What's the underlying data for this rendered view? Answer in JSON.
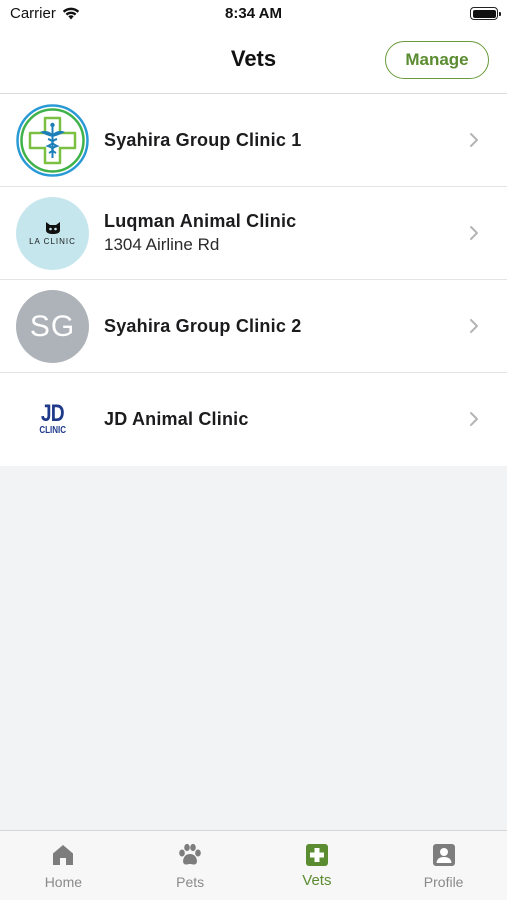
{
  "status_bar": {
    "carrier": "Carrier",
    "time": "8:34 AM"
  },
  "nav": {
    "title": "Vets",
    "manage_label": "Manage"
  },
  "vets": [
    {
      "name": "Syahira Group Clinic 1",
      "address": "",
      "avatar": "caduceus-cross-logo"
    },
    {
      "name": "Luqman Animal Clinic",
      "address": "1304 Airline Rd",
      "avatar": "la-clinic-logo",
      "logo_text": "LA CLINIC"
    },
    {
      "name": "Syahira Group Clinic 2",
      "address": "",
      "avatar": "initials",
      "initials": "SG"
    },
    {
      "name": "JD Animal Clinic",
      "address": "",
      "avatar": "jd-clinic-logo",
      "logo_big": "JD",
      "logo_small": "CLINIC"
    }
  ],
  "tabs": [
    {
      "label": "Home",
      "icon": "home-icon",
      "active": false
    },
    {
      "label": "Pets",
      "icon": "paw-icon",
      "active": false
    },
    {
      "label": "Vets",
      "icon": "medical-cross-icon",
      "active": true
    },
    {
      "label": "Profile",
      "icon": "profile-icon",
      "active": false
    }
  ],
  "colors": {
    "accent": "#5b8c31",
    "inactive_tab": "#8a8a8a",
    "background": "#f2f3f4",
    "initials_avatar": "#adb3b8",
    "la_avatar": "#c6e6ee",
    "jd_logo": "#1f3a8a"
  }
}
